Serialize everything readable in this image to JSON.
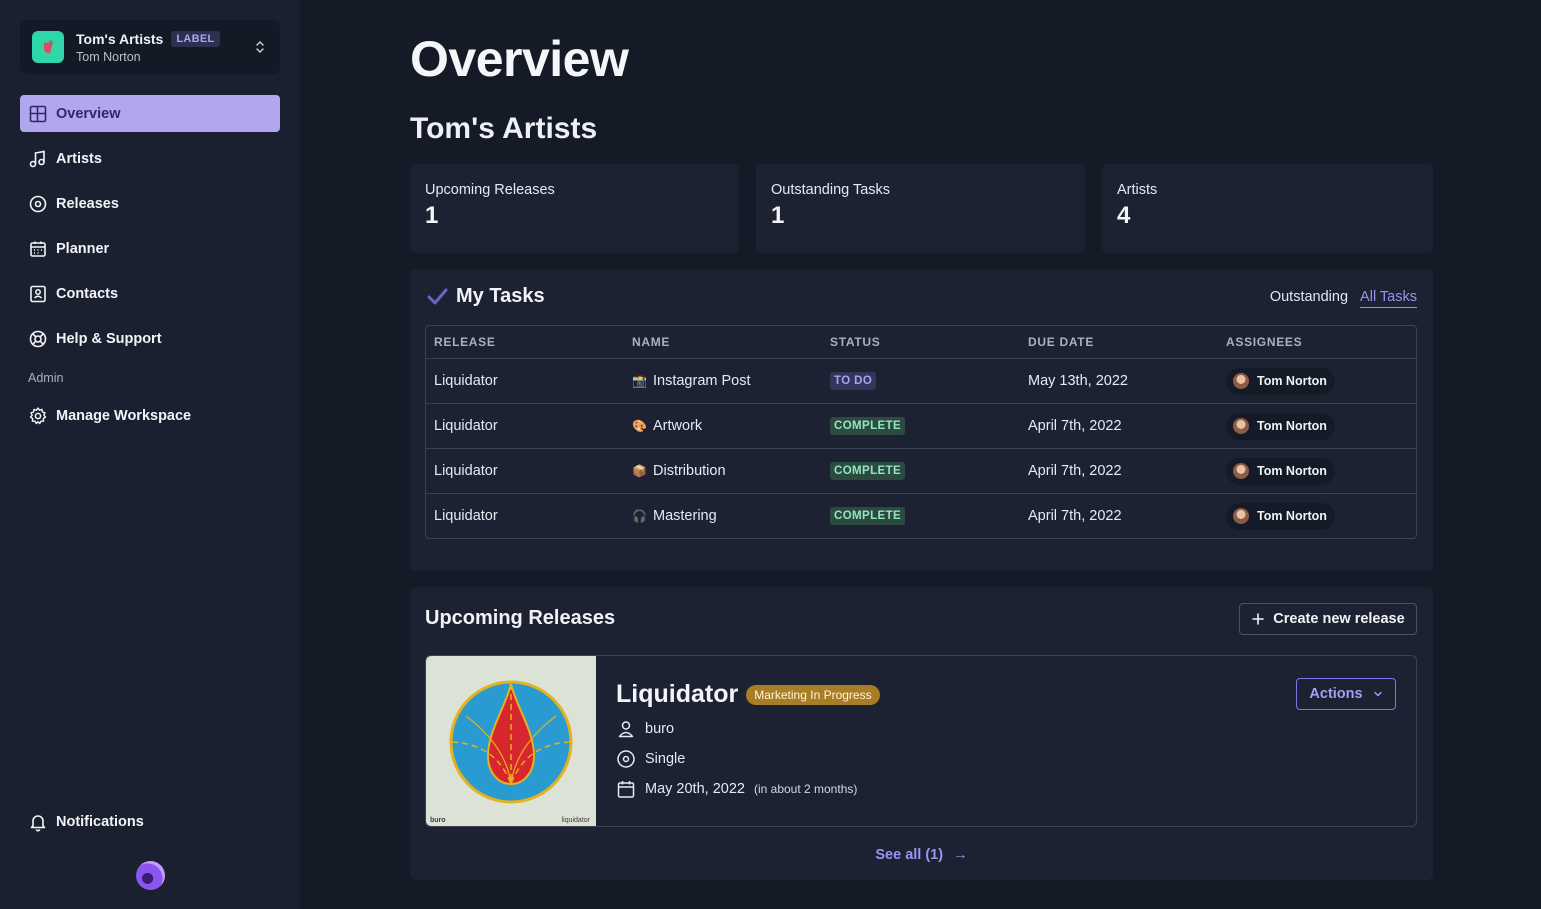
{
  "workspace": {
    "name": "Tom's Artists",
    "badge": "LABEL",
    "user": "Tom Norton"
  },
  "nav": {
    "items": [
      {
        "label": "Overview",
        "icon": "layout-icon"
      },
      {
        "label": "Artists",
        "icon": "music-note-icon"
      },
      {
        "label": "Releases",
        "icon": "disc-icon"
      },
      {
        "label": "Planner",
        "icon": "calendar-icon"
      },
      {
        "label": "Contacts",
        "icon": "contacts-icon"
      },
      {
        "label": "Help & Support",
        "icon": "lifebuoy-icon"
      }
    ],
    "admin_label": "Admin",
    "manage_workspace": "Manage Workspace",
    "notifications": "Notifications"
  },
  "page": {
    "title": "Overview",
    "workspace_title": "Tom's Artists"
  },
  "stats": [
    {
      "label": "Upcoming Releases",
      "value": "1"
    },
    {
      "label": "Outstanding Tasks",
      "value": "1"
    },
    {
      "label": "Artists",
      "value": "4"
    }
  ],
  "tasks": {
    "title": "My Tasks",
    "tabs": [
      "Outstanding",
      "All Tasks"
    ],
    "headers": [
      "RELEASE",
      "NAME",
      "STATUS",
      "DUE DATE",
      "ASSIGNEES"
    ],
    "rows": [
      {
        "release": "Liquidator",
        "icon": "📸",
        "name": "Instagram Post",
        "status": "TO DO",
        "due": "May 13th, 2022",
        "assignee": "Tom Norton"
      },
      {
        "release": "Liquidator",
        "icon": "🎨",
        "name": "Artwork",
        "status": "COMPLETE",
        "due": "April 7th, 2022",
        "assignee": "Tom Norton"
      },
      {
        "release": "Liquidator",
        "icon": "📦",
        "name": "Distribution",
        "status": "COMPLETE",
        "due": "April 7th, 2022",
        "assignee": "Tom Norton"
      },
      {
        "release": "Liquidator",
        "icon": "🎧",
        "name": "Mastering",
        "status": "COMPLETE",
        "due": "April 7th, 2022",
        "assignee": "Tom Norton"
      }
    ]
  },
  "releases": {
    "title": "Upcoming Releases",
    "create_label": "Create new release",
    "see_all": "See all (1)",
    "card": {
      "name": "Liquidator",
      "status": "Marketing In Progress",
      "artist": "buro",
      "type": "Single",
      "date": "May 20th, 2022",
      "relative": "(in about 2 months)",
      "actions": "Actions",
      "cover_left": "buro",
      "cover_right": "liquidator"
    }
  }
}
